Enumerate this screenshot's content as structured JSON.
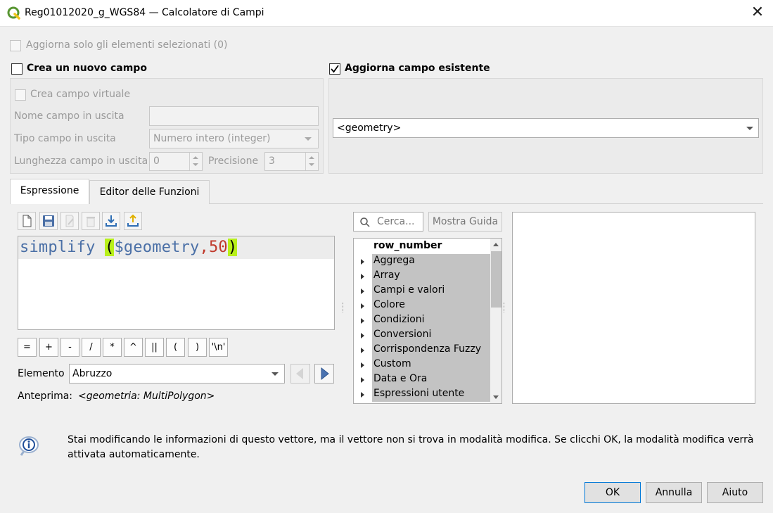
{
  "window": {
    "title": "Reg01012020_g_WGS84 — Calcolatore di Campi",
    "close": "✕"
  },
  "top": {
    "update_selected": "Aggiorna solo gli elementi selezionati (0)",
    "create_new": "Crea un nuovo campo",
    "update_existing": "Aggiorna campo esistente"
  },
  "new_field": {
    "virtual": "Crea campo virtuale",
    "name_label": "Nome campo in uscita",
    "name_value": "",
    "type_label": "Tipo campo in uscita",
    "type_value": "Numero intero (integer)",
    "length_label": "Lunghezza campo in uscita",
    "length_value": "0",
    "precision_label": "Precisione",
    "precision_value": "3"
  },
  "existing_field": {
    "selected": "<geometry>"
  },
  "tabs": [
    {
      "label": "Espressione"
    },
    {
      "label": "Editor delle Funzioni"
    }
  ],
  "expression": {
    "fn": "simplify ",
    "open": "(",
    "var": "$geometry",
    "comma": ",",
    "num": "50",
    "close": ")"
  },
  "operators": [
    "=",
    "+",
    "-",
    "/",
    "*",
    "^",
    "||",
    "(",
    ")",
    "'\\n'"
  ],
  "element": {
    "label": "Elemento",
    "value": "Abruzzo"
  },
  "preview": {
    "label": "Anteprima:",
    "value": "<geometria: MultiPolygon>"
  },
  "search": {
    "placeholder": "Cerca...",
    "help_button": "Mostra Guida"
  },
  "tree": [
    {
      "label": "row_number"
    },
    {
      "label": "Aggrega"
    },
    {
      "label": "Array"
    },
    {
      "label": "Campi e valori"
    },
    {
      "label": "Colore"
    },
    {
      "label": "Condizioni"
    },
    {
      "label": "Conversioni"
    },
    {
      "label": "Corrispondenza Fuzzy"
    },
    {
      "label": "Custom"
    },
    {
      "label": "Data e Ora"
    },
    {
      "label": "Espressioni utente"
    }
  ],
  "info": {
    "message": "Stai modificando le informazioni di questo vettore, ma il vettore non si trova in modalità modifica. Se clicchi OK, la modalità modifica verrà attivata automaticamente."
  },
  "buttons": {
    "ok": "OK",
    "cancel": "Annulla",
    "help": "Aiuto"
  },
  "colors": {
    "highlight": "#b8f01a",
    "function": "#4a6fa6",
    "number": "#c0392b",
    "default_button_border": "#0078d7"
  }
}
